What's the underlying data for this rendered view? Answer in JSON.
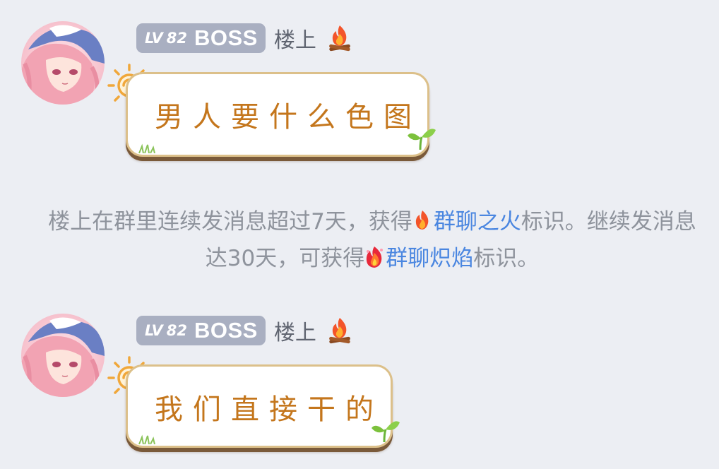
{
  "colors": {
    "background": "#eceef3",
    "level_badge": "#a9afc1",
    "bubble_border": "#dcc08a",
    "bubble_shadow": "#7a5a3a",
    "bubble_text": "#c4761c",
    "notice_text": "#8e939c",
    "badge_link": "#4a86e0"
  },
  "messages": [
    {
      "level_prefix": "LV",
      "level_number": "82",
      "level_title": "BOSS",
      "sender": "楼上",
      "status_icon": "campfire-icon",
      "text": "男人要什么色图"
    },
    {
      "level_prefix": "LV",
      "level_number": "82",
      "level_title": "BOSS",
      "sender": "楼上",
      "status_icon": "campfire-icon",
      "text": "我们直接干的"
    }
  ],
  "notice": {
    "part1": "楼上在群里连续发消息超过7天，获得",
    "badge1_icon": "fire-icon",
    "badge1": "群聊之火",
    "part2": "标识。继续发消息达30天，可获得",
    "badge2_icon": "blazing-fire-icon",
    "badge2": "群聊炽焰",
    "part3": "标识。"
  }
}
